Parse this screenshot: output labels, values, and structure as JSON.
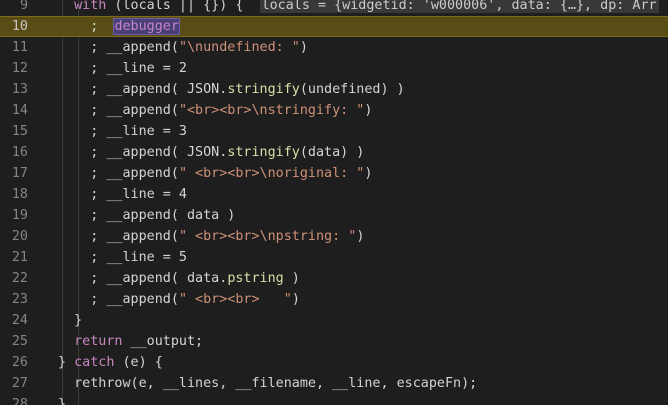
{
  "editor": {
    "highlighted_line": "10",
    "lines": [
      {
        "num": "9",
        "tokens": [
          {
            "t": "  ",
            "c": ""
          },
          {
            "t": "with",
            "c": "kw"
          },
          {
            "t": " (locals || {}) {  ",
            "c": ""
          },
          {
            "t": "locals = {widgetid: 'w000006', data: {…}, dp: Arr",
            "c": "inline-val"
          }
        ]
      },
      {
        "num": "10",
        "tokens": [
          {
            "t": "    ;  ",
            "c": ""
          },
          {
            "t": "debugger",
            "c": "dbg"
          }
        ]
      },
      {
        "num": "11",
        "tokens": [
          {
            "t": "    ; __append(",
            "c": ""
          },
          {
            "t": "\"\\nundefined: \"",
            "c": "str"
          },
          {
            "t": ")",
            "c": ""
          }
        ]
      },
      {
        "num": "12",
        "tokens": [
          {
            "t": "    ; __line = 2",
            "c": ""
          }
        ]
      },
      {
        "num": "13",
        "tokens": [
          {
            "t": "    ; __append( JSON.",
            "c": ""
          },
          {
            "t": "stringify",
            "c": "fn"
          },
          {
            "t": "(undefined) )",
            "c": ""
          }
        ]
      },
      {
        "num": "14",
        "tokens": [
          {
            "t": "    ; __append(",
            "c": ""
          },
          {
            "t": "\"<br><br>\\nstringify: \"",
            "c": "str"
          },
          {
            "t": ")",
            "c": ""
          }
        ]
      },
      {
        "num": "15",
        "tokens": [
          {
            "t": "    ; __line = 3",
            "c": ""
          }
        ]
      },
      {
        "num": "16",
        "tokens": [
          {
            "t": "    ; __append( JSON.",
            "c": ""
          },
          {
            "t": "stringify",
            "c": "fn"
          },
          {
            "t": "(data) )",
            "c": ""
          }
        ]
      },
      {
        "num": "17",
        "tokens": [
          {
            "t": "    ; __append(",
            "c": ""
          },
          {
            "t": "\" <br><br>\\noriginal: \"",
            "c": "str"
          },
          {
            "t": ")",
            "c": ""
          }
        ]
      },
      {
        "num": "18",
        "tokens": [
          {
            "t": "    ; __line = 4",
            "c": ""
          }
        ]
      },
      {
        "num": "19",
        "tokens": [
          {
            "t": "    ; __append( data )",
            "c": ""
          }
        ]
      },
      {
        "num": "20",
        "tokens": [
          {
            "t": "    ; __append(",
            "c": ""
          },
          {
            "t": "\" <br><br>\\npstring: \"",
            "c": "str"
          },
          {
            "t": ")",
            "c": ""
          }
        ]
      },
      {
        "num": "21",
        "tokens": [
          {
            "t": "    ; __line = 5",
            "c": ""
          }
        ]
      },
      {
        "num": "22",
        "tokens": [
          {
            "t": "    ; __append( data.",
            "c": ""
          },
          {
            "t": "pstring",
            "c": "fn"
          },
          {
            "t": " )",
            "c": ""
          }
        ]
      },
      {
        "num": "23",
        "tokens": [
          {
            "t": "    ; __append(",
            "c": ""
          },
          {
            "t": "\" <br><br>   \"",
            "c": "str"
          },
          {
            "t": ")",
            "c": ""
          }
        ]
      },
      {
        "num": "24",
        "tokens": [
          {
            "t": "  }",
            "c": ""
          }
        ]
      },
      {
        "num": "25",
        "tokens": [
          {
            "t": "  ",
            "c": ""
          },
          {
            "t": "return",
            "c": "kw"
          },
          {
            "t": " __output;",
            "c": ""
          }
        ]
      },
      {
        "num": "26",
        "tokens": [
          {
            "t": "} ",
            "c": ""
          },
          {
            "t": "catch",
            "c": "kw"
          },
          {
            "t": " (e) {",
            "c": ""
          }
        ]
      },
      {
        "num": "27",
        "tokens": [
          {
            "t": "  rethrow(e, __lines, __filename, __line, escapeFn);",
            "c": ""
          }
        ]
      },
      {
        "num": "28",
        "tokens": [
          {
            "t": "}",
            "c": ""
          }
        ]
      }
    ]
  },
  "colors": {
    "background": "#1e1e1e",
    "keyword": "#c586c0",
    "string": "#ce9178",
    "function": "#dcdcaa",
    "highlight": "#5a4c15"
  }
}
